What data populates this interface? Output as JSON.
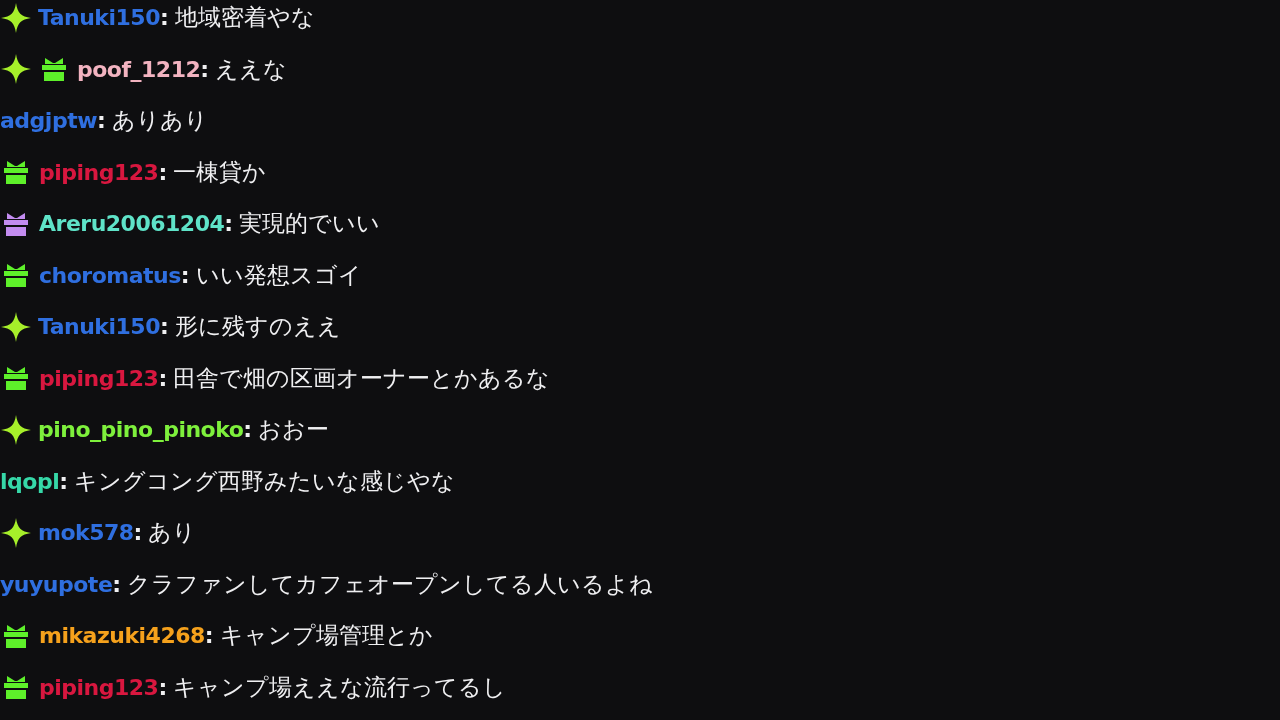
{
  "chat": {
    "messages": [
      {
        "badges": [
          {
            "kind": "sparkle",
            "color": "#a6ef2a"
          }
        ],
        "user": "Tanuki150",
        "color": "#2f6fe0",
        "colon": ":",
        "text": "地域密着やな"
      },
      {
        "badges": [
          {
            "kind": "sparkle",
            "color": "#a6ef2a"
          },
          {
            "kind": "gift",
            "color": "#5ef02a"
          }
        ],
        "user": "poof_1212",
        "color": "#f2b3c0",
        "colon": ":",
        "text": "ええな"
      },
      {
        "user": "adgjptw",
        "color": "#2f6fe0",
        "colon": ":",
        "text": "ありあり"
      },
      {
        "badges": [
          {
            "kind": "gift",
            "color": "#5ef02a"
          }
        ],
        "user": "piping123",
        "color": "#d8173f",
        "colon": ":",
        "text": "一棟貸か"
      },
      {
        "badges": [
          {
            "kind": "gift",
            "color": "#c38cf0"
          }
        ],
        "user": "Areru20061204",
        "color": "#5fe3c8",
        "colon": ":",
        "text": "実現的でいい"
      },
      {
        "badges": [
          {
            "kind": "gift",
            "color": "#5ef02a"
          }
        ],
        "user": "choromatus",
        "color": "#2f6fe0",
        "colon": ":",
        "text": "いい発想スゴイ"
      },
      {
        "badges": [
          {
            "kind": "sparkle",
            "color": "#a6ef2a"
          }
        ],
        "user": "Tanuki150",
        "color": "#2f6fe0",
        "colon": ":",
        "text": "形に残すのええ"
      },
      {
        "badges": [
          {
            "kind": "gift",
            "color": "#5ef02a"
          }
        ],
        "user": "piping123",
        "color": "#d8173f",
        "colon": ":",
        "text": "田舎で畑の区画オーナーとかあるな"
      },
      {
        "badges": [
          {
            "kind": "sparkle",
            "color": "#a6ef2a"
          }
        ],
        "user": "pino_pino_pinoko",
        "color": "#7ef03c",
        "colon": ":",
        "text": "おおー"
      },
      {
        "user": "lqopl",
        "color": "#36d8a8",
        "colon": ":",
        "text": "キングコング西野みたいな感じやな"
      },
      {
        "badges": [
          {
            "kind": "sparkle",
            "color": "#a6ef2a"
          }
        ],
        "user": "mok578",
        "color": "#2f6fe0",
        "colon": ":",
        "text": "あり"
      },
      {
        "user": "yuyupote",
        "color": "#2f6fe0",
        "colon": ":",
        "text": "クラファンしてカフェオープンしてる人いるよね"
      },
      {
        "badges": [
          {
            "kind": "gift",
            "color": "#5ef02a"
          }
        ],
        "user": "mikazuki4268",
        "color": "#f5a11c",
        "colon": ":",
        "text": "キャンプ場管理とか"
      },
      {
        "badges": [
          {
            "kind": "gift",
            "color": "#5ef02a"
          }
        ],
        "user": "piping123",
        "color": "#d8173f",
        "colon": ":",
        "text": "キャンプ場ええな流行ってるし"
      }
    ]
  }
}
